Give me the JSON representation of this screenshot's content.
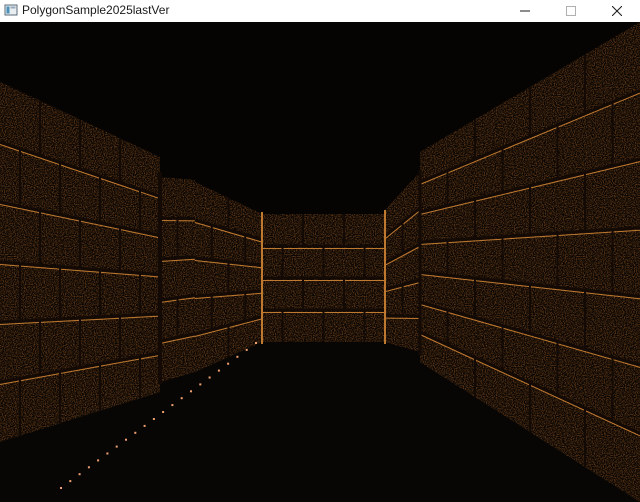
{
  "window": {
    "title": "PolygonSample2025lastVer"
  },
  "titlebar_buttons": {
    "minimize_icon": "minimize-icon",
    "maximize_icon": "maximize-icon",
    "close_icon": "close-icon"
  },
  "colors": {
    "sky": "#060403",
    "floor": "#080605",
    "brick_light": "#9a5a22",
    "brick_dark": "#3a2212",
    "brick_highlight": "#c07a30",
    "mortar": "#140a05",
    "floor_sparkle": "#f0a070"
  }
}
